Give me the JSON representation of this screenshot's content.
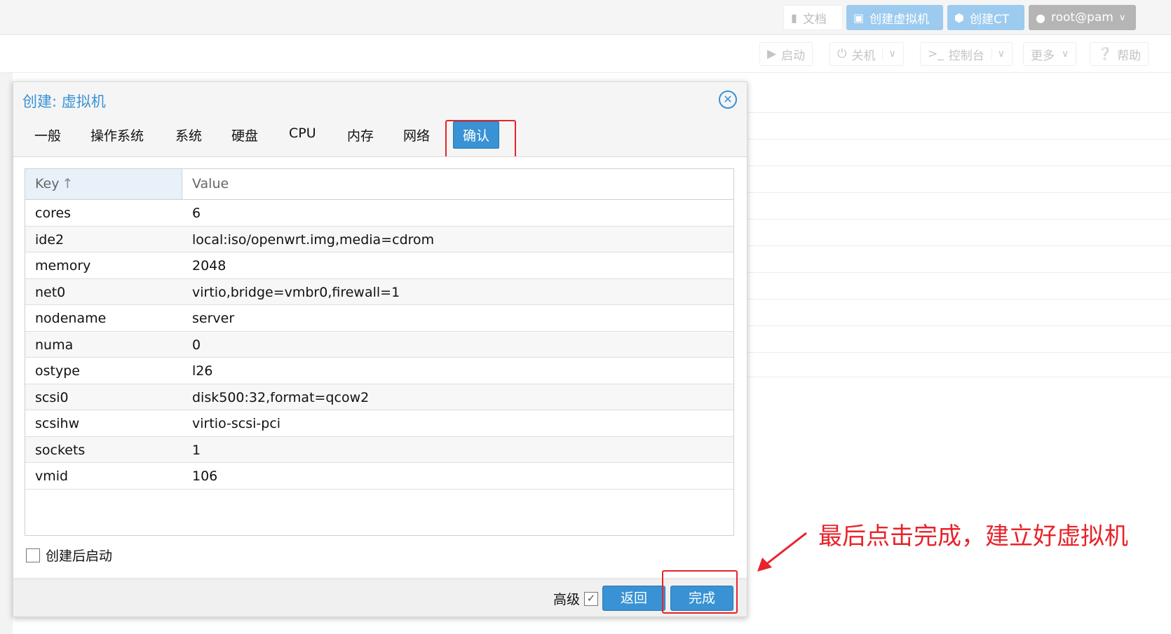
{
  "topbar": {
    "docs": "文档",
    "create_vm": "创建虚拟机",
    "create_ct": "创建CT",
    "user": "root@pam"
  },
  "toolbar": {
    "start": "启动",
    "shutdown": "关机",
    "console": "控制台",
    "more": "更多",
    "help": "帮助"
  },
  "dialog": {
    "title": "创建: 虚拟机",
    "tabs": [
      "一般",
      "操作系统",
      "系统",
      "硬盘",
      "CPU",
      "内存",
      "网络",
      "确认"
    ],
    "active_tab": "确认",
    "grid": {
      "col_key": "Key",
      "col_value": "Value",
      "rows": [
        {
          "key": "cores",
          "value": "6"
        },
        {
          "key": "ide2",
          "value": "local:iso/openwrt.img,media=cdrom"
        },
        {
          "key": "memory",
          "value": "2048"
        },
        {
          "key": "net0",
          "value": "virtio,bridge=vmbr0,firewall=1"
        },
        {
          "key": "nodename",
          "value": "server"
        },
        {
          "key": "numa",
          "value": "0"
        },
        {
          "key": "ostype",
          "value": "l26"
        },
        {
          "key": "scsi0",
          "value": "disk500:32,format=qcow2"
        },
        {
          "key": "scsihw",
          "value": "virtio-scsi-pci"
        },
        {
          "key": "sockets",
          "value": "1"
        },
        {
          "key": "vmid",
          "value": "106"
        }
      ]
    },
    "start_after_create": "创建后启动",
    "advanced": "高级",
    "back": "返回",
    "finish": "完成"
  },
  "annotation": "最后点击完成，建立好虚拟机",
  "colors": {
    "accent": "#3892d4",
    "highlight": "#e8232a"
  }
}
